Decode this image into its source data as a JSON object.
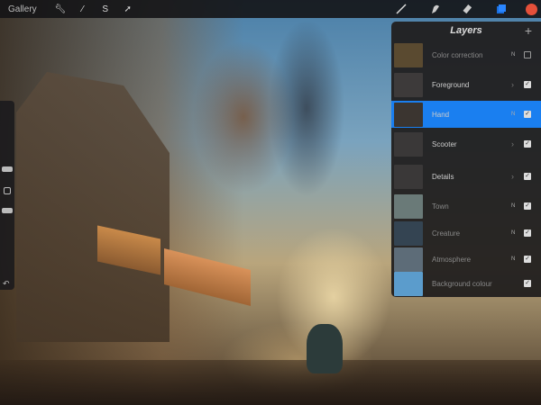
{
  "toolbar": {
    "gallery": "Gallery",
    "left_icons": [
      "wrench-icon",
      "magic-wand-icon",
      "selection-icon",
      "transform-arrow-icon"
    ],
    "right_icons": [
      "brush-icon",
      "smudge-icon",
      "eraser-icon",
      "layers-icon"
    ],
    "color": "#e4503a"
  },
  "layers": {
    "title": "Layers",
    "add": "+",
    "items": [
      {
        "name": "Color correction",
        "mode": "N",
        "visible": false,
        "group": false,
        "selected": false,
        "thumb": "#5a4a30"
      },
      {
        "name": "Foreground",
        "mode": "",
        "visible": true,
        "group": true,
        "selected": false,
        "thumb": "#3d3a3a"
      },
      {
        "name": "Hand",
        "mode": "N",
        "visible": true,
        "group": false,
        "selected": true,
        "thumb": "#3b3530"
      },
      {
        "name": "Scooter",
        "mode": "",
        "visible": true,
        "group": true,
        "selected": false,
        "thumb": "#3a3838"
      },
      {
        "name": "Details",
        "mode": "",
        "visible": true,
        "group": true,
        "selected": false,
        "thumb": "#3a3838"
      },
      {
        "name": "Town",
        "mode": "N",
        "visible": true,
        "group": false,
        "selected": false,
        "thumb": "#6a7a78"
      },
      {
        "name": "Creature",
        "mode": "N",
        "visible": true,
        "group": false,
        "selected": false,
        "thumb": "#344452"
      },
      {
        "name": "Atmosphere",
        "mode": "N",
        "visible": true,
        "group": false,
        "selected": false,
        "thumb": "#5d6c78"
      },
      {
        "name": "Background colour",
        "mode": "",
        "visible": true,
        "group": false,
        "selected": false,
        "thumb": "#5b9ccc"
      }
    ]
  },
  "chevron": "›",
  "check": "✓"
}
